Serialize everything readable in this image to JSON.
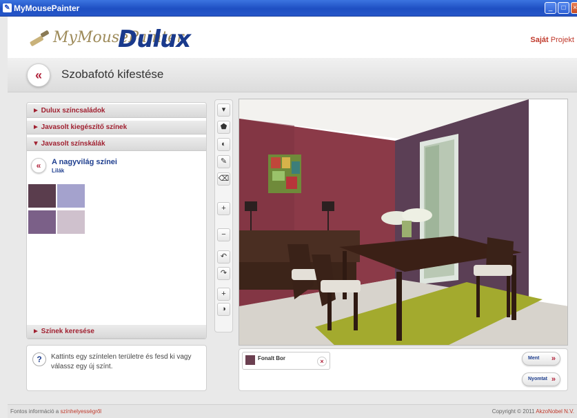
{
  "window": {
    "title": "MyMousePainter",
    "app_icon": "paint-icon"
  },
  "header": {
    "logo_my": "MyMousePainter",
    "logo_brand": "Dulux",
    "project_bold": "Saját",
    "project_rest": "Projekt"
  },
  "page": {
    "back_label": "«",
    "title": "Szobafotó kifestése"
  },
  "sidebar": {
    "sections": [
      {
        "label": "► Dulux színcsaládok"
      },
      {
        "label": "► Javasolt kiegészítő színek"
      },
      {
        "label": "▼ Javasolt színskálák"
      }
    ],
    "palette": {
      "back_label": "«",
      "title": "A nagyvilág színei",
      "subtitle": "Lilák",
      "swatches": [
        "#5a3d4d",
        "#a4a2cd",
        "#7b6088",
        "#cfc1cd"
      ]
    },
    "search_section": "► Színek keresése"
  },
  "help": {
    "icon": "?",
    "text": "Kattints egy színtelen területre és fesd ki vagy válassz egy új színt."
  },
  "tools": [
    "▾",
    "⬟",
    "◐",
    "✎",
    "⌫",
    "+",
    "−",
    "↶",
    "↷",
    "+",
    "◑"
  ],
  "selected_color": {
    "name": "Fonalt Bor",
    "hex": "#6b3f50",
    "remove": "×"
  },
  "actions": {
    "save": "Ment",
    "print": "Nyomtat",
    "arrow": "»"
  },
  "footer": {
    "info_prefix": "Fontos információ a",
    "info_link": "színhelyességről",
    "copyright_prefix": "Copyright © 2011",
    "copyright_link": "AkzoNobel N.V."
  },
  "colors": {
    "accent": "#b0223a",
    "brand": "#1a3a8c",
    "wall_left": "#8b3a48",
    "wall_right": "#5b3f55"
  }
}
